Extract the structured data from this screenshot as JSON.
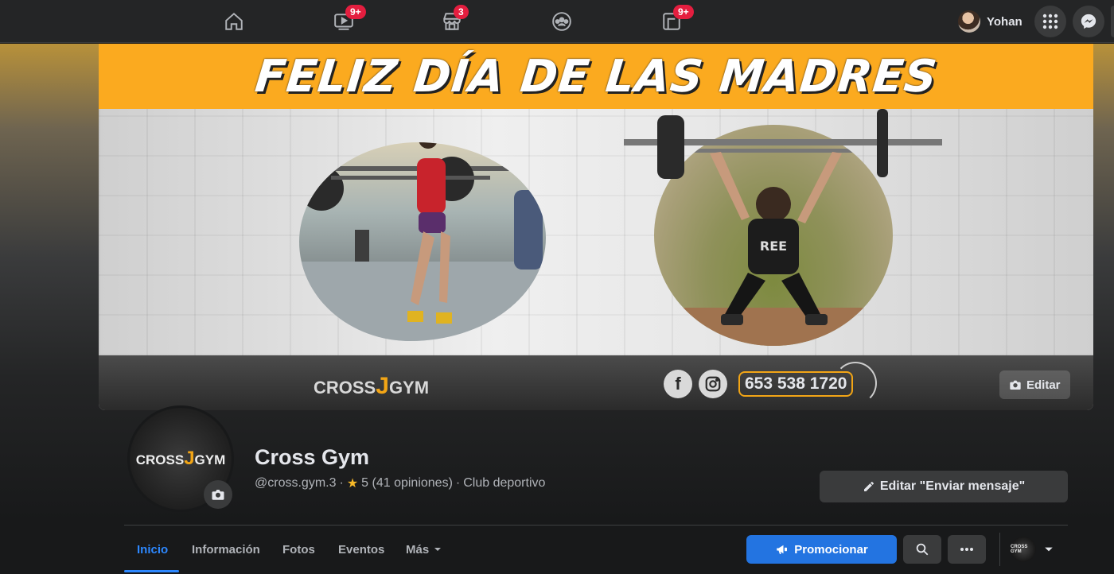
{
  "topbar": {
    "nav_items": [
      {
        "icon": "home-icon",
        "badge": ""
      },
      {
        "icon": "watch-icon",
        "badge": "9+"
      },
      {
        "icon": "marketplace-icon",
        "badge": "3"
      },
      {
        "icon": "groups-icon",
        "badge": ""
      },
      {
        "icon": "gaming-icon",
        "badge": "9+"
      }
    ],
    "user_name": "Yohan"
  },
  "cover": {
    "headline": "FELIZ DÍA DE LAS MADRES",
    "logo_text_left": "CROSS",
    "logo_text_right": "GYM",
    "logo_mark": "J",
    "phone": "653 538 1720",
    "facebook_glyph": "f",
    "edit_label": "Editar"
  },
  "profile": {
    "logo_left": "CROSS",
    "logo_right": "GYM",
    "logo_mark": "J",
    "name": "Cross Gym",
    "handle": "@cross.gym.3",
    "separator": "·",
    "rating": "5 (41 opiniones)",
    "category": "Club deportivo",
    "edit_message_label": "Editar \"Enviar mensaje\""
  },
  "tabs": {
    "items": [
      {
        "label": "Inicio",
        "active": true
      },
      {
        "label": "Información",
        "active": false
      },
      {
        "label": "Fotos",
        "active": false
      },
      {
        "label": "Eventos",
        "active": false
      },
      {
        "label": "Más",
        "active": false
      }
    ],
    "promote_label": "Promocionar",
    "switcher_avatar_text": "CROSS GYM"
  },
  "colors": {
    "accent": "#2d88ff",
    "promote": "#2374e1",
    "badge": "#e41e3f",
    "banner": "#fbaa1f",
    "logo_orange": "#f2a516"
  }
}
